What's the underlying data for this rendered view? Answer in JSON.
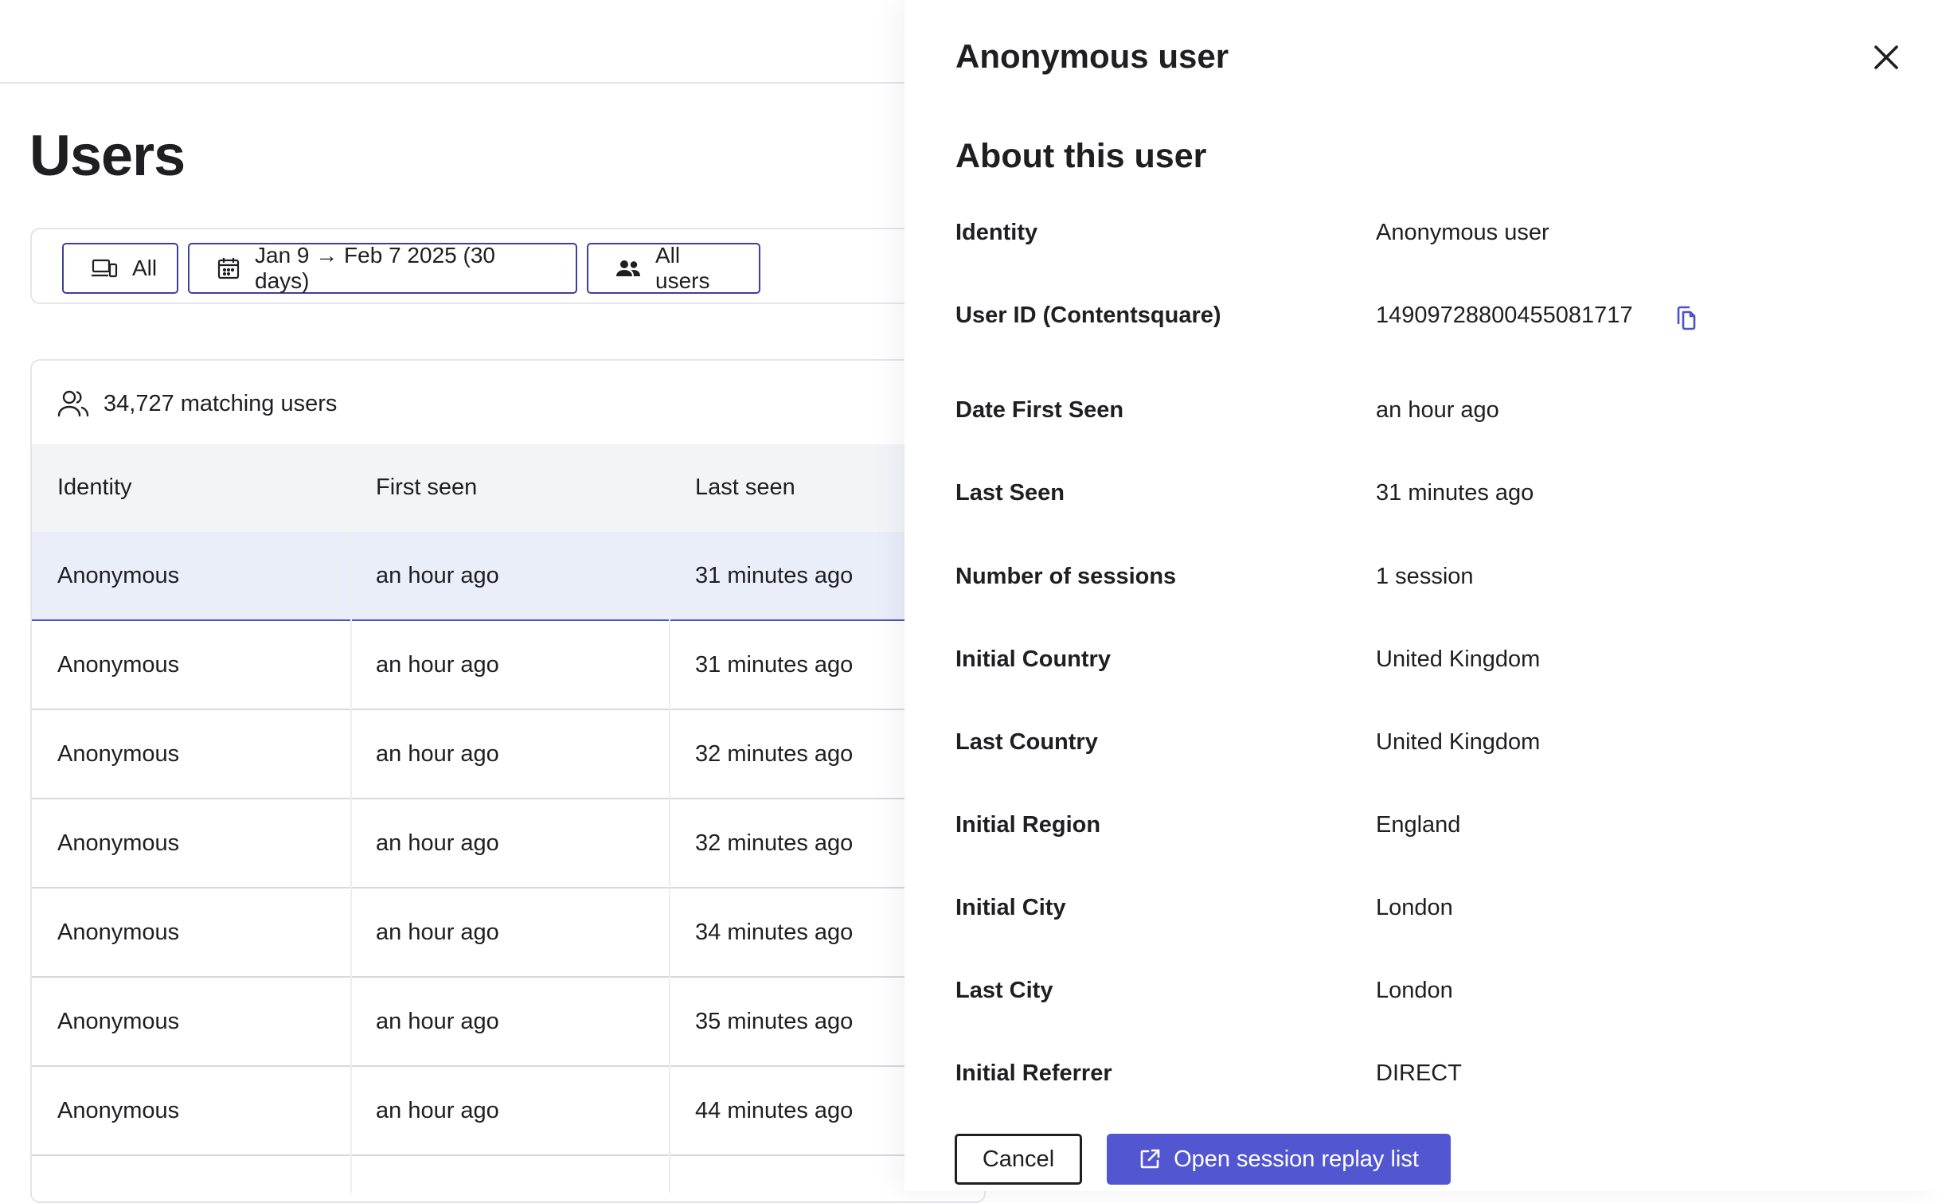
{
  "page": {
    "title": "Users"
  },
  "filters": {
    "device_label": "All",
    "date_range_label": "Jan 9 → Feb 7 2025 (30 days)",
    "segment_label": "All users"
  },
  "users": {
    "match_count_label": "34,727 matching users",
    "columns": [
      "Identity",
      "First seen",
      "Last seen"
    ],
    "rows": [
      {
        "identity": "Anonymous",
        "first_seen": "an hour ago",
        "last_seen": "31 minutes ago",
        "selected": true
      },
      {
        "identity": "Anonymous",
        "first_seen": "an hour ago",
        "last_seen": "31 minutes ago"
      },
      {
        "identity": "Anonymous",
        "first_seen": "an hour ago",
        "last_seen": "32 minutes ago"
      },
      {
        "identity": "Anonymous",
        "first_seen": "an hour ago",
        "last_seen": "32 minutes ago"
      },
      {
        "identity": "Anonymous",
        "first_seen": "an hour ago",
        "last_seen": "34 minutes ago"
      },
      {
        "identity": "Anonymous",
        "first_seen": "an hour ago",
        "last_seen": "35 minutes ago"
      },
      {
        "identity": "Anonymous",
        "first_seen": "an hour ago",
        "last_seen": "44 minutes ago"
      }
    ]
  },
  "panel": {
    "title": "Anonymous user",
    "section_title": "About this user",
    "details": [
      {
        "label": "Identity",
        "value": "Anonymous user"
      },
      {
        "label": "User ID (Contentsquare)",
        "value": "1490972880045508171​7",
        "copyable": true
      },
      {
        "label": "Date First Seen",
        "value": "an hour ago"
      },
      {
        "label": "Last Seen",
        "value": "31 minutes ago"
      },
      {
        "label": "Number of sessions",
        "value": "1 session"
      },
      {
        "label": "Initial Country",
        "value": "United Kingdom"
      },
      {
        "label": "Last Country",
        "value": "United Kingdom"
      },
      {
        "label": "Initial Region",
        "value": "England"
      },
      {
        "label": "Initial City",
        "value": "London"
      },
      {
        "label": "Last City",
        "value": "London"
      },
      {
        "label": "Initial Referrer",
        "value": "DIRECT"
      }
    ],
    "cancel_label": "Cancel",
    "open_replay_label": "Open session replay list"
  },
  "colors": {
    "accent": "#5257d1",
    "filter_border": "#3c4199",
    "selected_row_bg": "#e9eef9",
    "header_bg": "#f2f4f8"
  },
  "icons": [
    "devices-icon",
    "calendar-icon",
    "users-group-icon",
    "users-outline-icon",
    "close-icon",
    "copy-icon",
    "external-link-icon"
  ]
}
